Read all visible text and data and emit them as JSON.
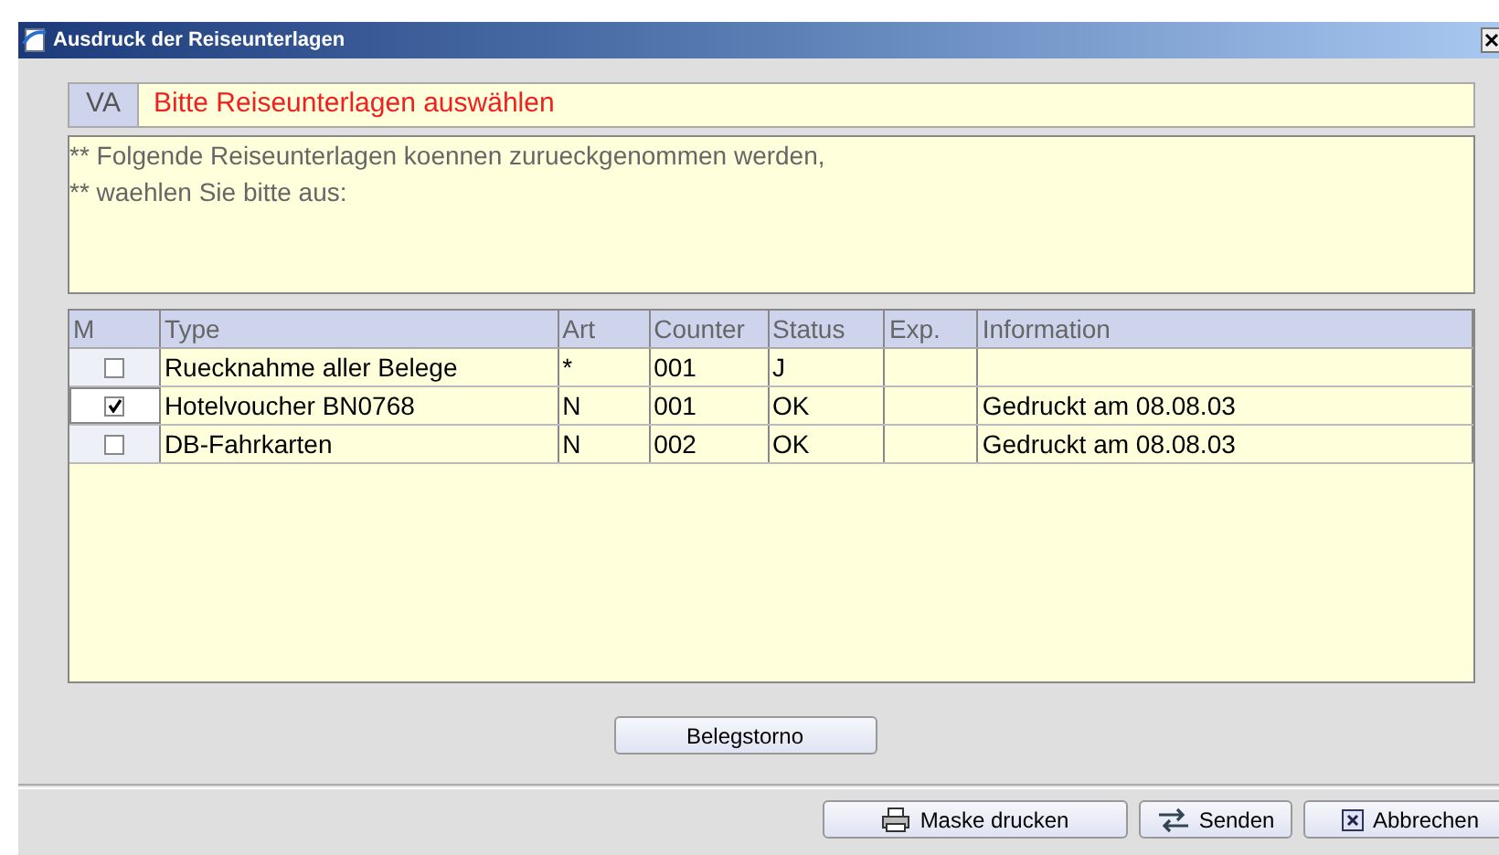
{
  "window": {
    "title": "Ausdruck der Reiseunterlagen"
  },
  "header": {
    "code": "VA",
    "message": "Bitte Reiseunterlagen auswählen"
  },
  "notes": [
    "** Folgende Reiseunterlagen koennen zurueckgenommen werden,",
    "** waehlen Sie bitte aus:"
  ],
  "table": {
    "columns": [
      "M",
      "Type",
      "Art",
      "Counter",
      "Status",
      "Exp.",
      "Information"
    ],
    "rows": [
      {
        "checked": false,
        "type": "Ruecknahme aller Belege",
        "art": "*",
        "counter": "001",
        "status": "J",
        "information": ""
      },
      {
        "checked": true,
        "type": "Hotelvoucher BN0768",
        "art": "N",
        "counter": "001",
        "status": "OK",
        "information": "Gedruckt am 08.08.03"
      },
      {
        "checked": false,
        "type": "DB-Fahrkarten",
        "art": "N",
        "counter": "002",
        "status": "OK",
        "information": "Gedruckt am 08.08.03"
      }
    ]
  },
  "action_button": "Belegstorno",
  "footer_buttons": [
    {
      "kind": "print",
      "label": "Maske drucken"
    },
    {
      "kind": "send",
      "label": "Senden"
    },
    {
      "kind": "cancel",
      "label": "Abbrechen"
    }
  ]
}
